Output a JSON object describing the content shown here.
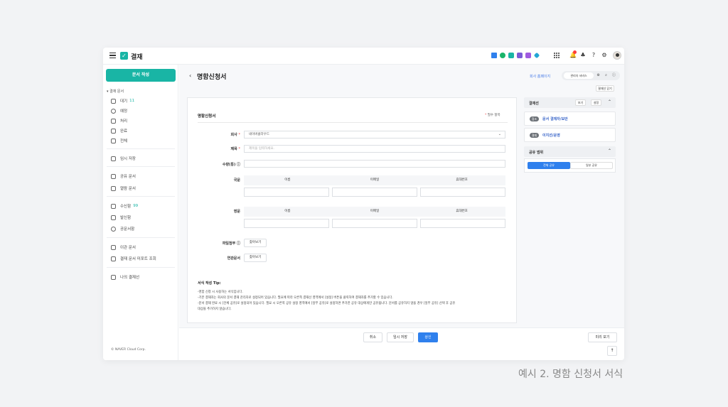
{
  "app": {
    "title": "결재"
  },
  "colors": {
    "brand": "#19b5a5",
    "primary": "#2f80ed",
    "link": "#4a7de8"
  },
  "topbar_icons": [
    "home-icon",
    "talk-icon",
    "mail-icon",
    "calendar-icon",
    "note-icon",
    "drive-icon",
    "apps-grid-icon",
    "bell-icon",
    "org-icon",
    "help-icon",
    "settings-icon"
  ],
  "sidebar": {
    "write_button": "문서 작성",
    "section_label": "▾ 결재 문서",
    "approval_items": [
      {
        "label": "대기",
        "count": "11",
        "icon": "hourglass-icon"
      },
      {
        "label": "예정",
        "icon": "clock-icon"
      },
      {
        "label": "처리",
        "icon": "handshake-icon"
      },
      {
        "label": "완료",
        "icon": "check-doc-icon"
      },
      {
        "label": "전체",
        "icon": "tray-icon"
      }
    ],
    "draft": {
      "label": "임시 저장",
      "icon": "draft-icon"
    },
    "doc_items": [
      {
        "label": "공유 문서",
        "icon": "share-doc-icon"
      },
      {
        "label": "열람 문서",
        "icon": "view-doc-icon"
      }
    ],
    "mail_items": [
      {
        "label": "수신함",
        "count": "99",
        "icon": "inbox-icon"
      },
      {
        "label": "발신함",
        "icon": "outbox-icon"
      },
      {
        "label": "공문서함",
        "icon": "official-doc-icon"
      }
    ],
    "old_items": [
      {
        "label": "이관 문서",
        "icon": "migrate-doc-icon"
      },
      {
        "label": "결재 문서 미포트 조회",
        "icon": "report-doc-icon"
      }
    ],
    "my_line": {
      "label": "나의 결재선",
      "icon": "approval-line-icon"
    },
    "copyright": "© NAVER Cloud Corp."
  },
  "main": {
    "back_icon": "chevron-left-icon",
    "title": "명함신청서",
    "home_link": "회사 홈페이지",
    "service_pill": "관리자 서비스",
    "collapse_button": "결재선 닫기"
  },
  "form": {
    "heading": "명함신청서",
    "required_note": "필수 항목",
    "required_mark": "*",
    "fields": {
      "company_label": "회사",
      "company_value": "네이버클라우드",
      "title_label": "제목",
      "title_placeholder": "제목을 입력하세요.",
      "qty_label": "수량(통)",
      "korean_label": "국문",
      "english_label": "영문",
      "attach_label": "파일첨부",
      "related_label": "연관문서",
      "find_button": "찾아보기",
      "find_button_2": "찾아보기"
    },
    "table_headers": [
      "이름",
      "이메일",
      "휴대번호"
    ],
    "tip": {
      "title": "서식 작성 Tip:",
      "lines": [
        "-명함 신청 시 사용하는 서식입니다.",
        "-기본 결재자는 회사의 문서 결재 관리자로 설정되어 있습니다. 필요에 따라 오른쪽 결재선 영역에서 [설정] 버튼을 클릭하여 결재자를 추가할 수 있습니다.",
        "-문서 결재 완료 시 [전체 공유]로 설정되어 있습니다. 필요 시 오른쪽 공유 설정 영역에서 [일부 공유]로 설정하면 추가한 공유 대상에게만 공유됩니다. 문서를 공유하지 않을 경우 [일부 공유] 선택 후 공유",
        "대상을 추가하지 않습니다."
      ]
    }
  },
  "right_panel": {
    "approval_title": "결재선",
    "view_button": "보기",
    "settings_button": "설정",
    "lines": [
      {
        "tag": "협조",
        "text": "문서 결재자/보안"
      },
      {
        "tag": "결재",
        "text": "이지선/운영"
      }
    ],
    "share_title": "공유 범위",
    "share_all": "전체 공유",
    "share_part": "일부 공유"
  },
  "bottom": {
    "cancel": "취소",
    "temp_save": "임시 저장",
    "submit": "상신",
    "preview": "미리 보기"
  },
  "caption": "예시 2. 명함 신청서 서식"
}
